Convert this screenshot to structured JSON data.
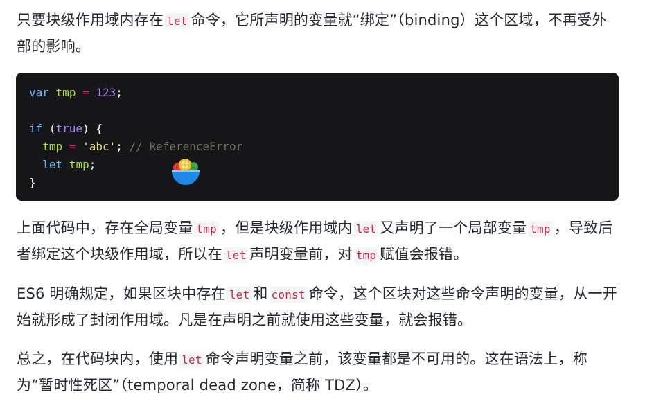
{
  "paragraph1": {
    "t1": "只要块级作用域内存在",
    "c1": "let",
    "t2": "命令，它所声明的变量就“绑定”（binding）这个区域，不再受外部的影响。"
  },
  "code": {
    "l1": {
      "kw": "var",
      "v": "tmp",
      "op": "=",
      "num": "123",
      "end": ";"
    },
    "l3": {
      "kw": "if",
      "open": " (",
      "bool": "true",
      "close": ") {"
    },
    "l4": {
      "v": "tmp",
      "op": "=",
      "str": "'abc'",
      "end": ";",
      "comment": "// ReferenceError"
    },
    "l5": {
      "kw": "let",
      "v": "tmp",
      "end": ";"
    },
    "l6": "}"
  },
  "paragraph2": {
    "t1": "上面代码中，存在全局变量",
    "c1": "tmp",
    "t2": "，但是块级作用域内",
    "c2": "let",
    "t3": "又声明了一个局部变量",
    "c3": "tmp",
    "t4": "，导致后者绑定这个块级作用域，所以在",
    "c4": "let",
    "t5": "声明变量前，对",
    "c5": "tmp",
    "t6": "赋值会报错。"
  },
  "paragraph3": {
    "t1": "ES6 明确规定，如果区块中存在",
    "c1": "let",
    "t2": "和",
    "c2": "const",
    "t3": "命令，这个区块对这些命令声明的变量，从一开始就形成了封闭作用域。凡是在声明之前就使用这些变量，就会报错。"
  },
  "paragraph4": {
    "t1": "总之，在代码块内，使用",
    "c1": "let",
    "t2": "命令声明变量之前，该变量都是不可用的。这在语法上，称为“暂时性死区”（temporal dead zone，简称 TDZ）。"
  },
  "overlay_icon": "fruit-bowl-icon"
}
